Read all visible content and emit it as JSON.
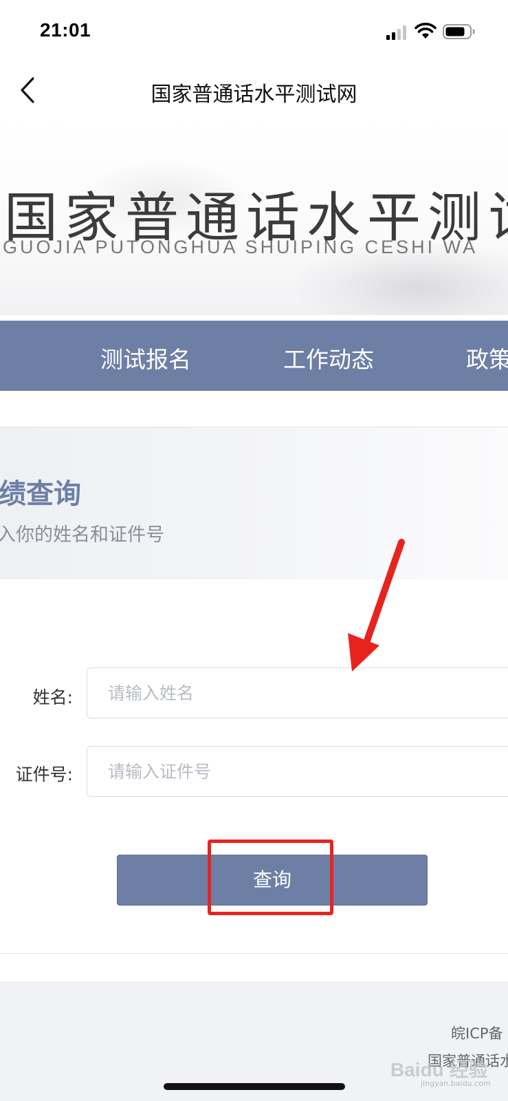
{
  "status_bar": {
    "time": "21:01"
  },
  "nav": {
    "title": "国家普通话水平测试网",
    "back_icon": "chevron-left-icon"
  },
  "banner": {
    "title": "国家普通话水平测试",
    "pinyin": "GUOJIA PUTONGHUA SHUIPING CESHI WA"
  },
  "menu": {
    "items": [
      {
        "label": "测试报名"
      },
      {
        "label": "工作动态"
      },
      {
        "label": "政策"
      }
    ]
  },
  "query": {
    "title": "绩查询",
    "subtitle": "入你的姓名和证件号"
  },
  "form": {
    "name_label": "姓名:",
    "name_placeholder": "请输入姓名",
    "id_label": "证件号:",
    "id_placeholder": "请输入证件号",
    "submit_label": "查询"
  },
  "footer": {
    "icp": "皖ICP备",
    "site": "国家普通话水"
  },
  "watermark": {
    "text": "Baidu 经验",
    "sub": "jingyan.baidu.com"
  },
  "colors": {
    "primary": "#6e7fa6",
    "annotation_red": "#e8231f",
    "footer_bg": "#f0f2f6"
  }
}
